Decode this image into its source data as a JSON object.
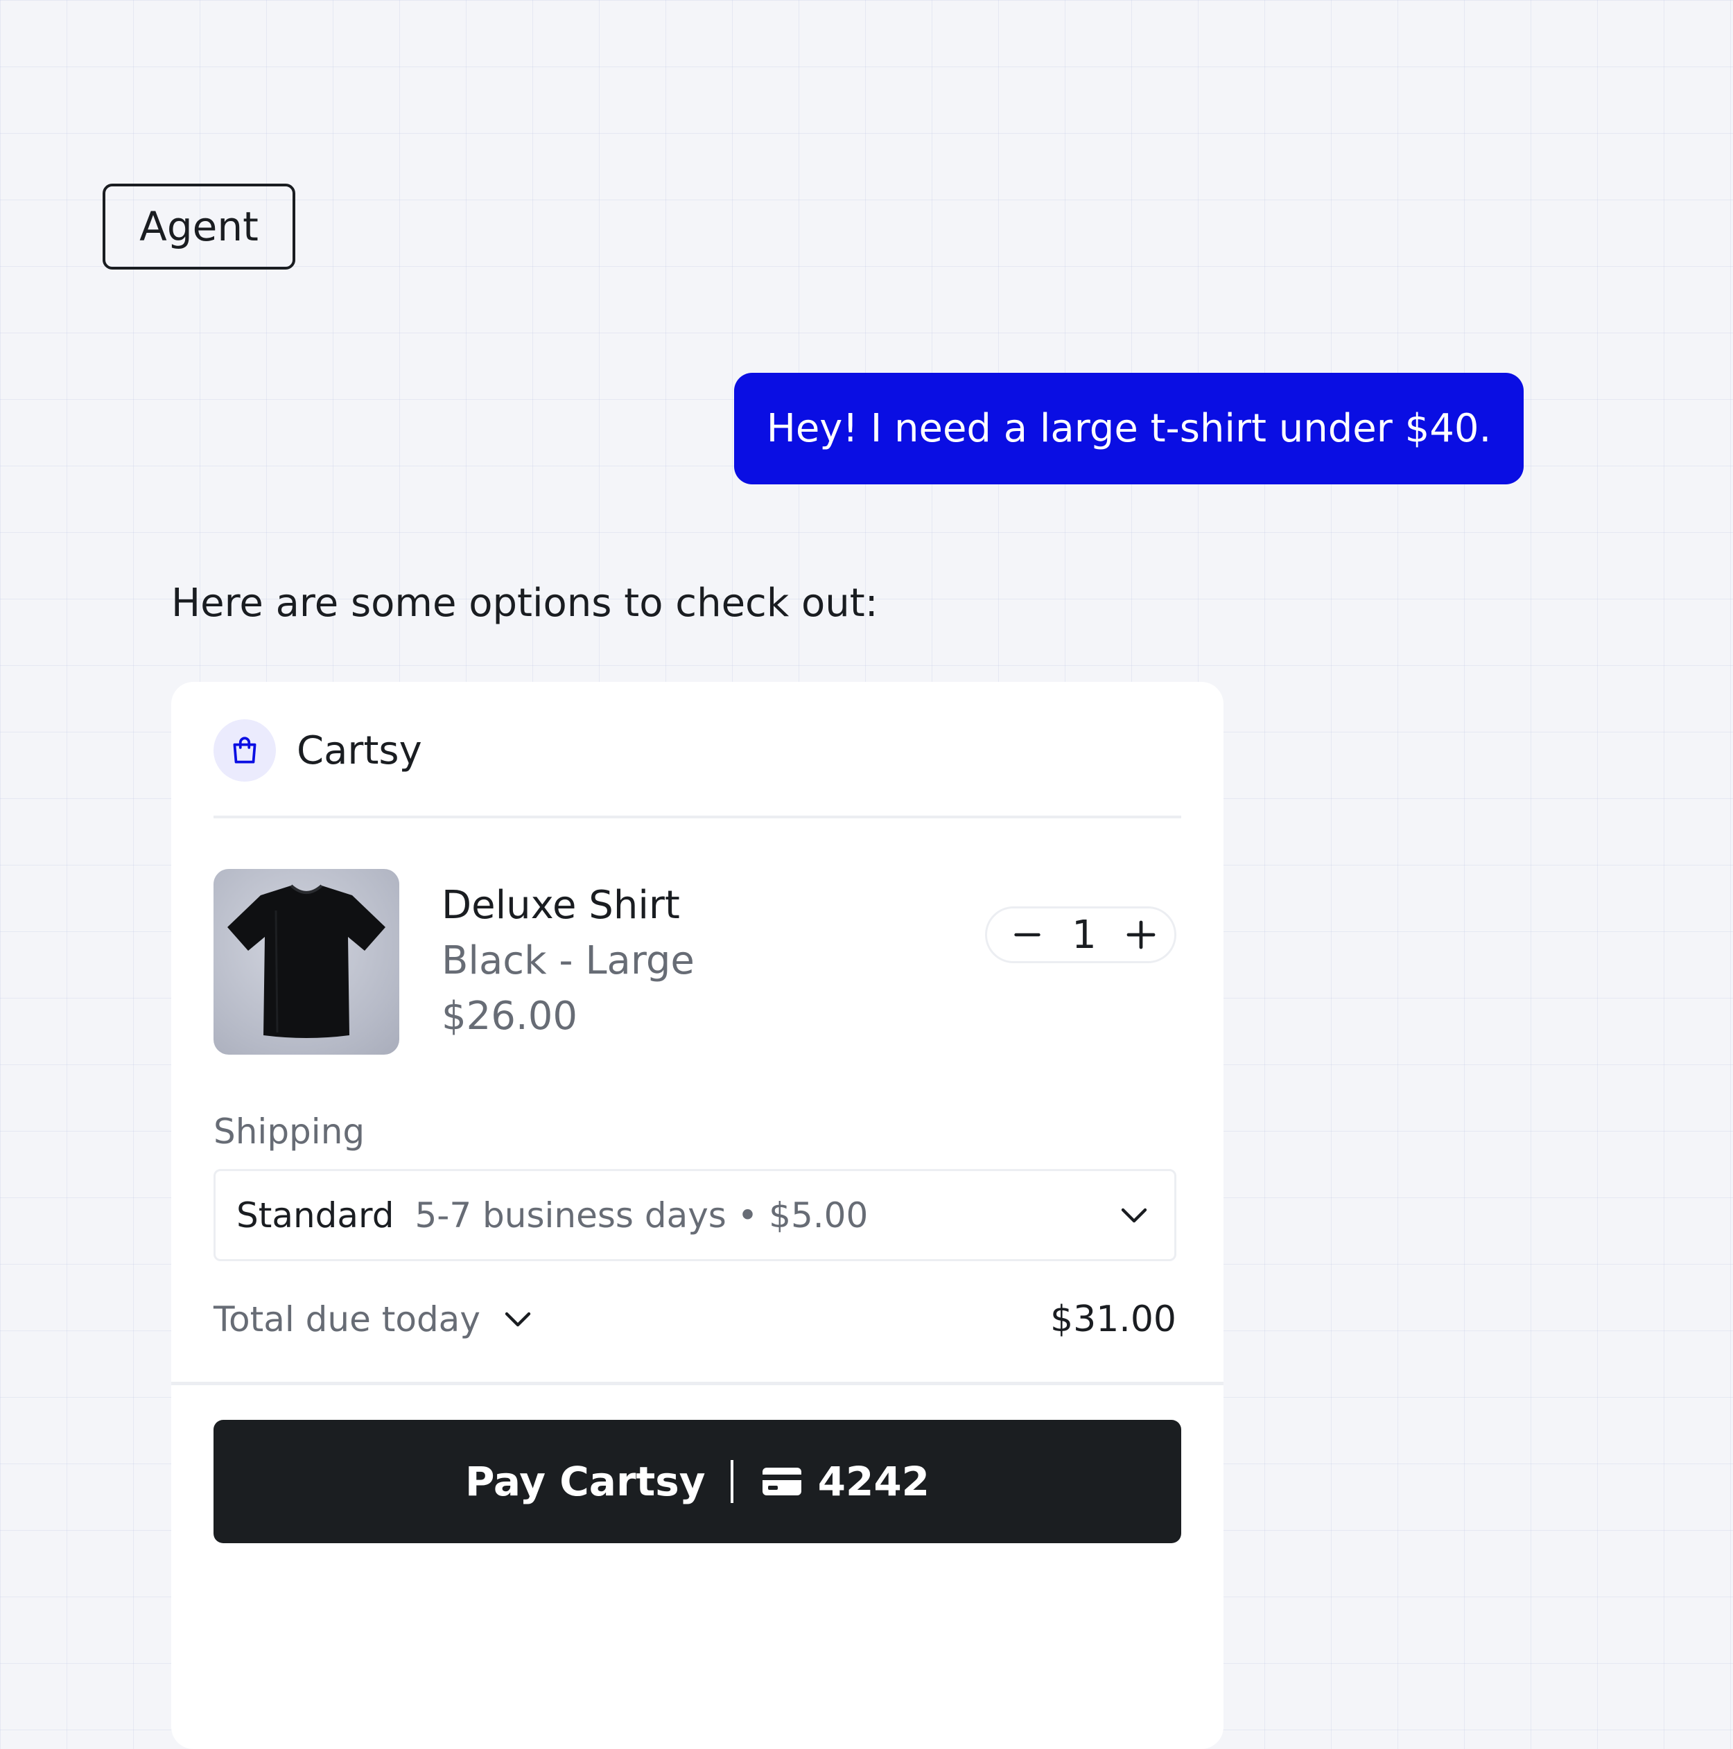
{
  "agent_tag": {
    "label": "Agent"
  },
  "user_message": {
    "text": "Hey! I need a large t-shirt under $40."
  },
  "agent_message": {
    "text": "Here are some options to check out:"
  },
  "checkout": {
    "merchant": {
      "name": "Cartsy",
      "icon": "shopping-bag-icon"
    },
    "product": {
      "name": "Deluxe Shirt",
      "variant": "Black - Large",
      "price": "$26.00",
      "image": "black-t-shirt",
      "quantity": "1"
    },
    "shipping": {
      "label": "Shipping",
      "selected_method": "Standard",
      "selected_detail": "5-7 business days • $5.00"
    },
    "total": {
      "label": "Total due today",
      "value": "$31.00"
    },
    "pay_button": {
      "label": "Pay Cartsy",
      "card_icon": "credit-card-icon",
      "card_last4": "4242"
    }
  },
  "colors": {
    "accent": "#0a0ee3",
    "pay_button_bg": "#1b1e21",
    "background": "#f4f5f9",
    "merchant_icon_bg": "#ebebfd"
  }
}
